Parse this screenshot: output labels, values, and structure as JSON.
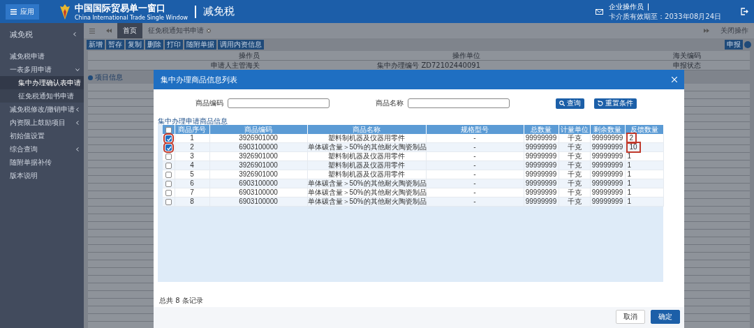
{
  "header": {
    "menu_button": "应用",
    "logo_title": "中国国际贸易单一窗口",
    "logo_subtitle": "China International Trade Single Window",
    "module": "减免税",
    "user_role": "企业操作员",
    "expiry": "卡介质有效期至：2033年08月24日"
  },
  "sidebar": {
    "title": "减免税",
    "items": [
      {
        "label": "减免税申请",
        "expandable": false,
        "selected": false
      },
      {
        "label": "一表多用申请",
        "expandable": true,
        "expanded": true,
        "selected": false,
        "children": [
          {
            "label": "集中办理确认表申请",
            "selected": true
          },
          {
            "label": "征免税通知书申请",
            "selected": false
          }
        ]
      },
      {
        "label": "减免税修改/撤销申请",
        "expandable": true,
        "expanded": false,
        "selected": false
      },
      {
        "label": "内资限上鼓励项目",
        "expandable": true,
        "expanded": false,
        "selected": false
      },
      {
        "label": "初始值设置",
        "expandable": false,
        "selected": false
      },
      {
        "label": "综合查询",
        "expandable": true,
        "expanded": false,
        "selected": false
      },
      {
        "label": "随附单据补传",
        "expandable": false,
        "selected": false
      },
      {
        "label": "版本说明",
        "expandable": false,
        "selected": false
      }
    ]
  },
  "tabs": [
    {
      "label": "首页",
      "selected": true,
      "closable": false
    },
    {
      "label": "征免税通知书申请",
      "selected": false,
      "closable": true
    }
  ],
  "close_ops": "关闭操作",
  "toolbar": [
    "新增",
    "暂存",
    "复制",
    "删除",
    "打印",
    "随附单据",
    "调用内资信息"
  ],
  "declare_button": "申报",
  "info_rows": [
    [
      {
        "label": "操作员"
      },
      {
        "label": "操作单位"
      },
      {
        "label": "海关编码"
      }
    ],
    [
      {
        "label": "申请人主管海关"
      },
      {
        "label": "集中办理编号 ZD72102440091"
      },
      {
        "label": "申报状态"
      }
    ]
  ],
  "section": "项目信息",
  "dialog": {
    "title": "集中办理商品信息列表",
    "search_fields": [
      {
        "label": "商品编码"
      },
      {
        "label": "商品名称"
      }
    ],
    "buttons": [
      "查询",
      "重置条件"
    ],
    "caption": "集中办理申请商品信息",
    "all_selected": false,
    "columns": [
      "商品序号",
      "商品编码",
      "商品名称",
      "规格型号",
      "总数量",
      "计量单位",
      "剩余数量",
      "反馈数量"
    ],
    "rows": [
      {
        "checked": true,
        "highlighted": true,
        "cells": [
          "1",
          "3926901000",
          "塑料制机器及仪器用零件",
          "-",
          "99999999",
          "千克",
          "99999999",
          "2"
        ]
      },
      {
        "checked": true,
        "highlighted": true,
        "cells": [
          "2",
          "6903100000",
          "单体碳含量＞50%的其他耐火陶瓷制品",
          "-",
          "99999999",
          "千克",
          "99999999",
          "10"
        ]
      },
      {
        "checked": false,
        "highlighted": false,
        "cells": [
          "3",
          "3926901000",
          "塑料制机器及仪器用零件",
          "-",
          "99999999",
          "千克",
          "99999999",
          "1"
        ]
      },
      {
        "checked": false,
        "highlighted": false,
        "cells": [
          "4",
          "3926901000",
          "塑料制机器及仪器用零件",
          "-",
          "99999999",
          "千克",
          "99999999",
          "1"
        ]
      },
      {
        "checked": false,
        "highlighted": false,
        "cells": [
          "5",
          "3926901000",
          "塑料制机器及仪器用零件",
          "-",
          "99999999",
          "千克",
          "99999999",
          "1"
        ]
      },
      {
        "checked": false,
        "highlighted": false,
        "cells": [
          "6",
          "6903100000",
          "单体碳含量＞50%的其他耐火陶瓷制品",
          "-",
          "99999999",
          "千克",
          "99999999",
          "1"
        ]
      },
      {
        "checked": false,
        "highlighted": false,
        "cells": [
          "7",
          "6903100000",
          "单体碳含量＞50%的其他耐火陶瓷制品",
          "-",
          "99999999",
          "千克",
          "99999999",
          "1"
        ]
      },
      {
        "checked": false,
        "highlighted": false,
        "cells": [
          "8",
          "6903100000",
          "单体碳含量＞50%的其他耐火陶瓷制品",
          "-",
          "99999999",
          "千克",
          "99999999",
          "1"
        ]
      }
    ],
    "total": "总共 8 条记录",
    "footer_buttons": [
      {
        "label": "取消",
        "kind": "secondary"
      },
      {
        "label": "确定",
        "kind": "primary"
      }
    ]
  }
}
